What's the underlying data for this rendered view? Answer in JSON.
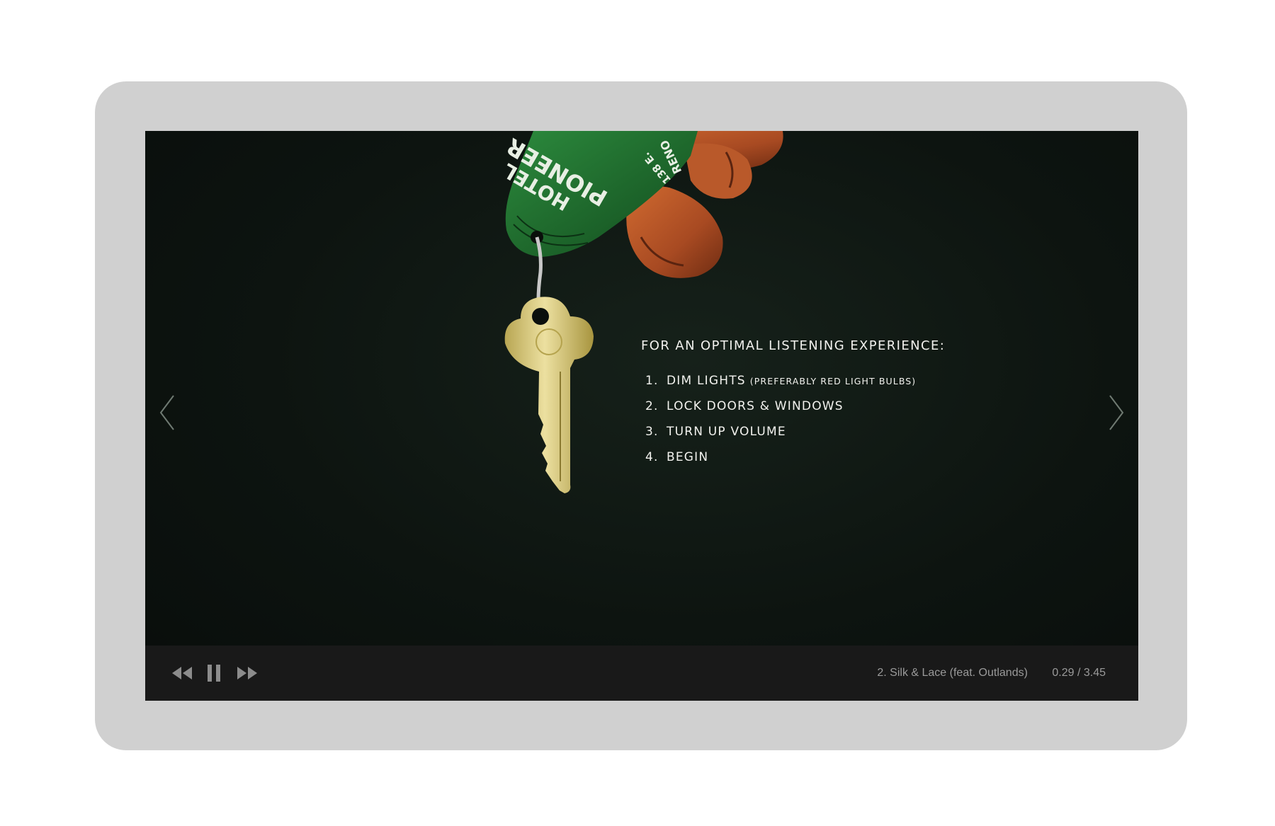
{
  "artwork": {
    "keytag_lines": [
      "PIONEER",
      "HOTEL",
      "138 E.",
      "RENO"
    ]
  },
  "navigation": {
    "prev_icon": "chevron-left-icon",
    "next_icon": "chevron-right-icon"
  },
  "instructions": {
    "title": "FOR AN OPTIMAL LISTENING EXPERIENCE:",
    "items": [
      {
        "number": "1.",
        "text": "DIM LIGHTS",
        "note": "(PREFERABLY RED LIGHT BULBS)"
      },
      {
        "number": "2.",
        "text": "LOCK DOORS & WINDOWS"
      },
      {
        "number": "3.",
        "text": "TURN UP VOLUME"
      },
      {
        "number": "4.",
        "text": "BEGIN"
      }
    ]
  },
  "player": {
    "controls": {
      "rewind_icon": "rewind-icon",
      "pause_icon": "pause-icon",
      "forward_icon": "fast-forward-icon"
    },
    "track_title": "2. Silk & Lace (feat. Outlands)",
    "time": "0.29 / 3.45",
    "colors": {
      "bar": "#191919",
      "controls": "#8c8c8c",
      "text": "#9a9a9a"
    }
  },
  "colors": {
    "frame": "#d0d0d0",
    "screen_bg": "#0d1410",
    "keytag_green": "#1f6b2e",
    "key_brass": "#d9c979",
    "glove_orange": "#b5572a",
    "instructions_text": "#f2f2ee"
  }
}
